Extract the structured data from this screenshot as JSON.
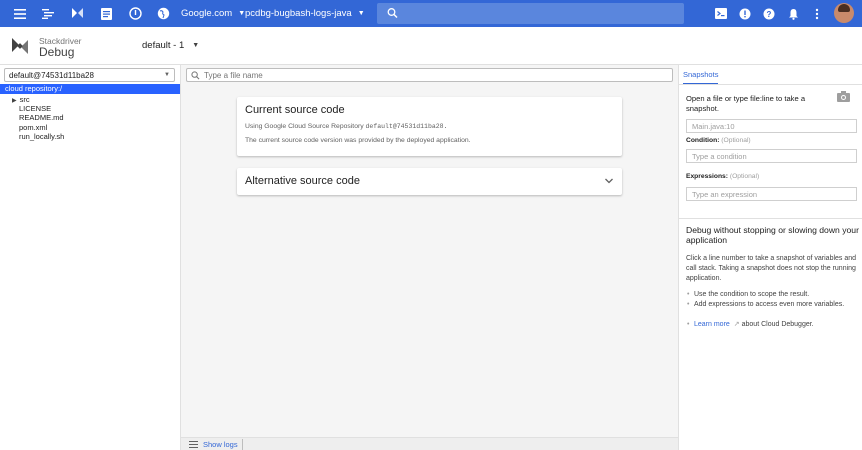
{
  "topbar": {
    "project_selector": "Google.com",
    "project_name": "pcdbg-bugbash-logs-java",
    "search_placeholder": ""
  },
  "header": {
    "brand_line1": "Stackdriver",
    "brand_line2": "Debug",
    "version_selector": "default - 1"
  },
  "left": {
    "branch_selector": "default@74531d11ba28",
    "repo_root": "cloud repository:/",
    "tree": [
      {
        "label": "src",
        "folder": true
      },
      {
        "label": "LICENSE"
      },
      {
        "label": "README.md"
      },
      {
        "label": "pom.xml"
      },
      {
        "label": "run_locally.sh"
      }
    ]
  },
  "center": {
    "file_search_placeholder": "Type a file name",
    "card1": {
      "title": "Current source code",
      "line1_prefix": "Using Google Cloud Source Repository",
      "line1_code": "default@74531d11ba28.",
      "line2": "The current source code version was provided by the deployed application."
    },
    "card2": {
      "title": "Alternative source code"
    },
    "show_logs": "Show logs"
  },
  "right": {
    "tab": "Snapshots",
    "intro": "Open a file or type file:line to take a snapshot.",
    "location_value": "Main.java:10",
    "condition_label": "Condition:",
    "condition_optional": "(Optional)",
    "condition_placeholder": "Type a condition",
    "expressions_label": "Expressions:",
    "expressions_optional": "(Optional)",
    "expressions_placeholder": "Type an expression",
    "info_title": "Debug without stopping or slowing down your application",
    "info_body": "Click a line number to take a snapshot of variables and call stack. Taking a snapshot does not stop the running application.",
    "bullet1": "Use the condition to scope the result.",
    "bullet2": "Add expressions to access even more variables.",
    "learn_more": "Learn more",
    "learn_more_suffix": "about Cloud Debugger."
  },
  "colors": {
    "topbar": "#3367d6",
    "selection": "#2962ff",
    "link": "#3367d6"
  }
}
